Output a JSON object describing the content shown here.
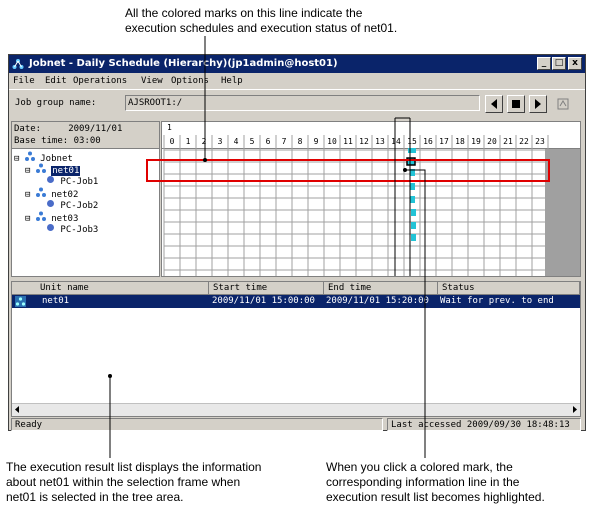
{
  "annotations": {
    "top_line1": "All the colored marks on this line indicate the",
    "top_line2": "execution schedules and execution status of net01.",
    "bottom_left1": "The execution result list displays the information",
    "bottom_left2": "about net01 within the selection frame when",
    "bottom_left3": "net01 is selected in the tree area.",
    "bottom_right1": "When you click a colored mark, the",
    "bottom_right2": "corresponding information line in the",
    "bottom_right3": "execution result list becomes highlighted."
  },
  "window": {
    "title": "Jobnet - Daily Schedule (Hierarchy)(jp1admin@host01)",
    "minimize": "_",
    "maximize": "□",
    "close": "x"
  },
  "menu": [
    "File",
    "Edit",
    "Operations",
    "View",
    "Options",
    "Help"
  ],
  "toolbar": {
    "job_group_label": "Job group name:",
    "job_group_value": "AJSROOT1:/"
  },
  "tree": {
    "date_label": "Date:",
    "date_value": "2009/11/01",
    "base_time_label": "Base time:",
    "base_time_value": "03:00",
    "nodes": [
      {
        "label": "Jobnet",
        "type": "root",
        "expander": "⊟"
      },
      {
        "label": "net01",
        "type": "jobnet",
        "expander": "⊟",
        "selected": true
      },
      {
        "label": "PC-Job1",
        "type": "job"
      },
      {
        "label": "net02",
        "type": "jobnet",
        "expander": "⊟"
      },
      {
        "label": "PC-Job2",
        "type": "job"
      },
      {
        "label": "net03",
        "type": "jobnet",
        "expander": "⊟"
      },
      {
        "label": "PC-Job3",
        "type": "job"
      }
    ]
  },
  "schedule": {
    "day": "1",
    "hours": [
      "0",
      "1",
      "2",
      "3",
      "4",
      "5",
      "6",
      "7",
      "8",
      "9",
      "10",
      "11",
      "12",
      "13",
      "14",
      "15",
      "16",
      "17",
      "18",
      "19",
      "20",
      "21",
      "22",
      "23"
    ],
    "highlight_hour_index": 15,
    "mark_color": "#22c3d6"
  },
  "result_list": {
    "columns": [
      "Unit name",
      "Start time",
      "End time",
      "Status"
    ],
    "rows": [
      {
        "unit": "net01",
        "start": "2009/11/01 15:00:00",
        "end": "2009/11/01 15:20:00",
        "status": "Wait for prev. to end"
      }
    ]
  },
  "status_bar": {
    "left": "Ready",
    "right": "Last accessed 2009/09/30 18:48:13"
  },
  "colors": {
    "selection_frame": "#e00000",
    "title_bar": "#0a246a",
    "highlight_row": "#0a246a"
  }
}
